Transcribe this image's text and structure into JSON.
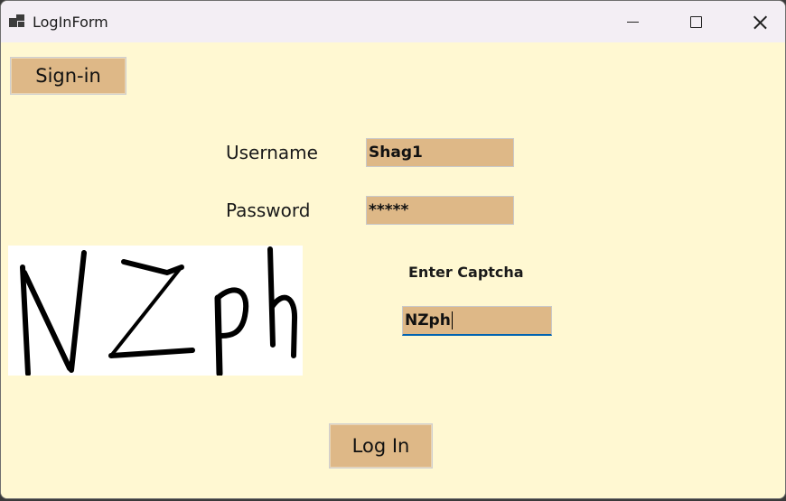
{
  "window": {
    "title": "LogInForm",
    "controls": [
      "minimize-icon",
      "maximize-icon",
      "close-icon"
    ]
  },
  "buttons": {
    "signin_label": "Sign-in",
    "login_label": "Log In"
  },
  "form": {
    "username_label": "Username",
    "username_value": "Shag1",
    "password_label": "Password",
    "password_value": "*****",
    "captcha_label": "Enter Captcha",
    "captcha_value": "NZph"
  },
  "captcha_image": {
    "text": "NZph"
  },
  "colors": {
    "background": "#fff8d2",
    "control": "#deb887",
    "focus_underline": "#0063b1"
  }
}
